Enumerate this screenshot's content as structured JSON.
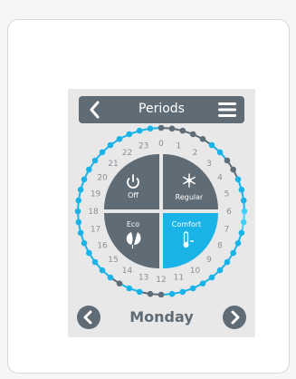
{
  "header": {
    "title": "Periods",
    "back_icon": "chevron-left-icon",
    "menu_icon": "hamburger-menu-icon"
  },
  "modes": {
    "off": {
      "label": "Off",
      "icon": "power-icon",
      "color": "#5f6b75"
    },
    "regular": {
      "label": "Regular",
      "icon": "snowflake-icon",
      "color": "#5f6b75"
    },
    "eco": {
      "label": "Eco",
      "icon": "leaf-icon",
      "color": "#5f6b75"
    },
    "comfort": {
      "label": "Comfort",
      "icon": "thermometer-icon",
      "color": "#1ab3e8",
      "selected": true
    }
  },
  "hours": [
    "0",
    "1",
    "2",
    "3",
    "4",
    "5",
    "6",
    "7",
    "8",
    "9",
    "10",
    "11",
    "12",
    "13",
    "14",
    "15",
    "16",
    "17",
    "18",
    "19",
    "20",
    "21",
    "22",
    "23"
  ],
  "ring": {
    "active_color": "#1ab3e8",
    "inactive_color": "#5f6b75",
    "highlight_color": "#42d0ff",
    "active_dot_indices": [
      5,
      6,
      9,
      10,
      11,
      12,
      13,
      14,
      15,
      16,
      17,
      18,
      19,
      20,
      21,
      22,
      23,
      26,
      27,
      29,
      30,
      31,
      32,
      33,
      34,
      35,
      36,
      37,
      38,
      39,
      40,
      41,
      42,
      43,
      44,
      45,
      46,
      47
    ],
    "highlight_dot_indices": [
      12,
      13
    ]
  },
  "footer": {
    "day": "Monday",
    "prev_icon": "chevron-left-circle-icon",
    "next_icon": "chevron-right-circle-icon"
  }
}
